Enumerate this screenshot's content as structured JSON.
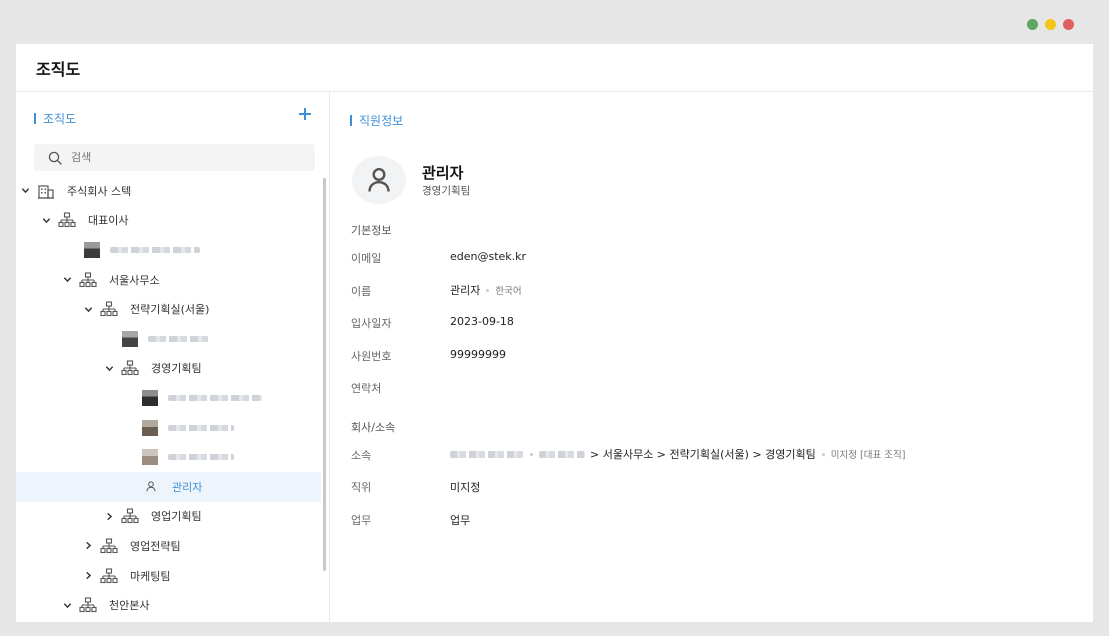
{
  "window": {
    "title": "조직도",
    "controls": {
      "minimize_color": "#5fa65e",
      "maximize_color": "#f5c518",
      "close_color": "#e06060"
    }
  },
  "left_panel": {
    "section_title": "조직도",
    "add_icon": "plus-icon",
    "search": {
      "placeholder": "검색",
      "icon": "search-icon"
    },
    "tree": [
      {
        "label": "주식회사 스텍",
        "type": "company",
        "expanded": true
      },
      {
        "label": "대표이사",
        "type": "org",
        "expanded": true
      },
      {
        "label": "",
        "type": "person-blurred"
      },
      {
        "label": "서울사무소",
        "type": "org",
        "expanded": true
      },
      {
        "label": "전략기획실(서울)",
        "type": "org",
        "expanded": true
      },
      {
        "label": "",
        "type": "person-blurred"
      },
      {
        "label": "경영기획팀",
        "type": "org",
        "expanded": true
      },
      {
        "label": "",
        "type": "person-blurred"
      },
      {
        "label": "",
        "type": "person-blurred"
      },
      {
        "label": "",
        "type": "person-blurred"
      },
      {
        "label": "관리자",
        "type": "person",
        "selected": true
      },
      {
        "label": "영업기획팀",
        "type": "org",
        "expanded": false
      },
      {
        "label": "영업전략팀",
        "type": "org",
        "expanded": false
      },
      {
        "label": "마케팅팀",
        "type": "org",
        "expanded": false
      },
      {
        "label": "천안본사",
        "type": "org",
        "expanded": true
      }
    ]
  },
  "right_panel": {
    "section_title": "직원정보",
    "profile": {
      "name": "관리자",
      "team": "경영기획팀",
      "avatar_icon": "user-icon"
    },
    "basic_info": {
      "title": "기본정보",
      "email_label": "이메일",
      "email": "eden@stek.kr",
      "name_label": "이름",
      "name": "관리자",
      "language": "한국어",
      "join_date_label": "입사일자",
      "join_date": "2023-09-18",
      "employee_no_label": "사원번호",
      "employee_no": "99999999",
      "contact_label": "연락처",
      "contact": ""
    },
    "company_info": {
      "title": "회사/소속",
      "dept_label": "소속",
      "dept_path": "> 서울사무소 > 전략기획실(서울) > 경영기획팀",
      "dept_note": "미지정 [대표 조직]",
      "position_label": "직위",
      "position": "미지정",
      "duty_label": "업무",
      "duty": "업무"
    }
  },
  "colors": {
    "accent": "#3d8fd8",
    "selected_bg": "#eef4fb"
  }
}
